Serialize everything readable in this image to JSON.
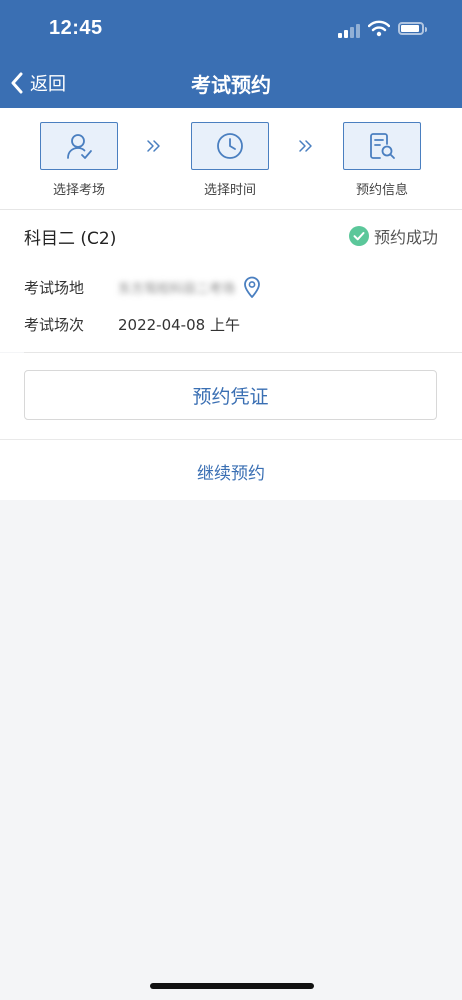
{
  "status_bar": {
    "time": "12:45"
  },
  "nav": {
    "back_label": "返回",
    "title": "考试预约"
  },
  "steps": [
    {
      "label": "选择考场",
      "icon": "person-check-icon"
    },
    {
      "label": "选择时间",
      "icon": "clock-icon"
    },
    {
      "label": "预约信息",
      "icon": "document-search-icon"
    }
  ],
  "booking": {
    "subject": "科目二 (C2)",
    "status": "预约成功",
    "venue_label": "考试场地",
    "venue_value": "东方驾校科目二考场",
    "session_label": "考试场次",
    "session_value": "2022-04-08 上午"
  },
  "actions": {
    "voucher": "预约凭证",
    "continue": "继续预约"
  },
  "colors": {
    "brand": "#3a6fb3",
    "success": "#5bc79a",
    "step_bg": "#e8f0fa"
  }
}
